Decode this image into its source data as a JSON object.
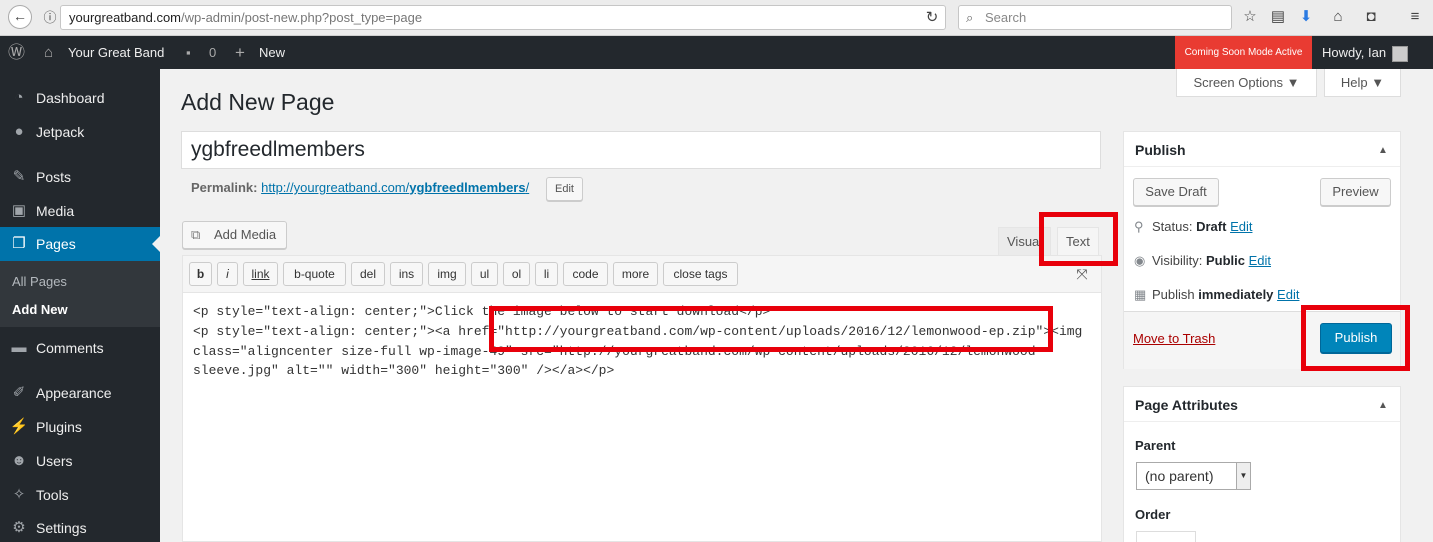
{
  "browser": {
    "url_domain": "yourgreatband.com",
    "url_path": "/wp-admin/post-new.php?post_type=page",
    "search_placeholder": "Search"
  },
  "adminbar": {
    "site_name": "Your Great Band",
    "comments_count": "0",
    "new_label": "New",
    "coming_soon": "Coming Soon Mode Active",
    "howdy": "Howdy, Ian"
  },
  "sidebar": {
    "items": [
      {
        "label": "Dashboard",
        "icon": "dashboard-icon"
      },
      {
        "label": "Jetpack",
        "icon": "jetpack-icon"
      },
      {
        "label": "Posts",
        "icon": "pin-icon"
      },
      {
        "label": "Media",
        "icon": "media-icon"
      },
      {
        "label": "Pages",
        "icon": "pages-icon"
      },
      {
        "label": "Comments",
        "icon": "comment-icon"
      },
      {
        "label": "Appearance",
        "icon": "brush-icon"
      },
      {
        "label": "Plugins",
        "icon": "plugin-icon"
      },
      {
        "label": "Users",
        "icon": "users-icon"
      },
      {
        "label": "Tools",
        "icon": "wrench-icon"
      },
      {
        "label": "Settings",
        "icon": "settings-icon"
      }
    ],
    "submenu": [
      "All Pages",
      "Add New"
    ]
  },
  "main": {
    "page_title": "Add New Page",
    "screen_options": "Screen Options ▼",
    "help": "Help ▼",
    "post_title": "ygbfreedlmembers",
    "permalink_label": "Permalink:",
    "permalink_base": "http://yourgreatband.com/",
    "permalink_slug": "ygbfreedlmembers",
    "permalink_end": "/",
    "permalink_edit": "Edit",
    "add_media": "Add Media",
    "tab_visual": "Visual",
    "tab_text": "Text",
    "quicktags": [
      "b",
      "i",
      "link",
      "b-quote",
      "del",
      "ins",
      "img",
      "ul",
      "ol",
      "li",
      "code",
      "more",
      "close tags"
    ],
    "code_lines": [
      "<p style=\"text-align: center;\">Click the image below to start download</p>",
      "<p style=\"text-align: center;\"><a href=\"http://yourgreatband.com/wp-content/uploads/2016/12/lemonwood-ep.zip\"><img",
      "class=\"aligncenter size-full wp-image-49\" src=\"http://yourgreatband.com/wp-content/uploads/2016/12/lemonwood-",
      "sleeve.jpg\" alt=\"\" width=\"300\" height=\"300\" /></a></p>"
    ]
  },
  "publish": {
    "title": "Publish",
    "save_draft": "Save Draft",
    "preview": "Preview",
    "status_label": "Status:",
    "status_value": "Draft",
    "visibility_label": "Visibility:",
    "visibility_value": "Public",
    "publish_label": "Publish",
    "publish_value": "immediately",
    "edit": "Edit",
    "move_to_trash": "Move to Trash",
    "publish_button": "Publish"
  },
  "page_attributes": {
    "title": "Page Attributes",
    "parent_label": "Parent",
    "parent_value": "(no parent)",
    "order_label": "Order"
  }
}
